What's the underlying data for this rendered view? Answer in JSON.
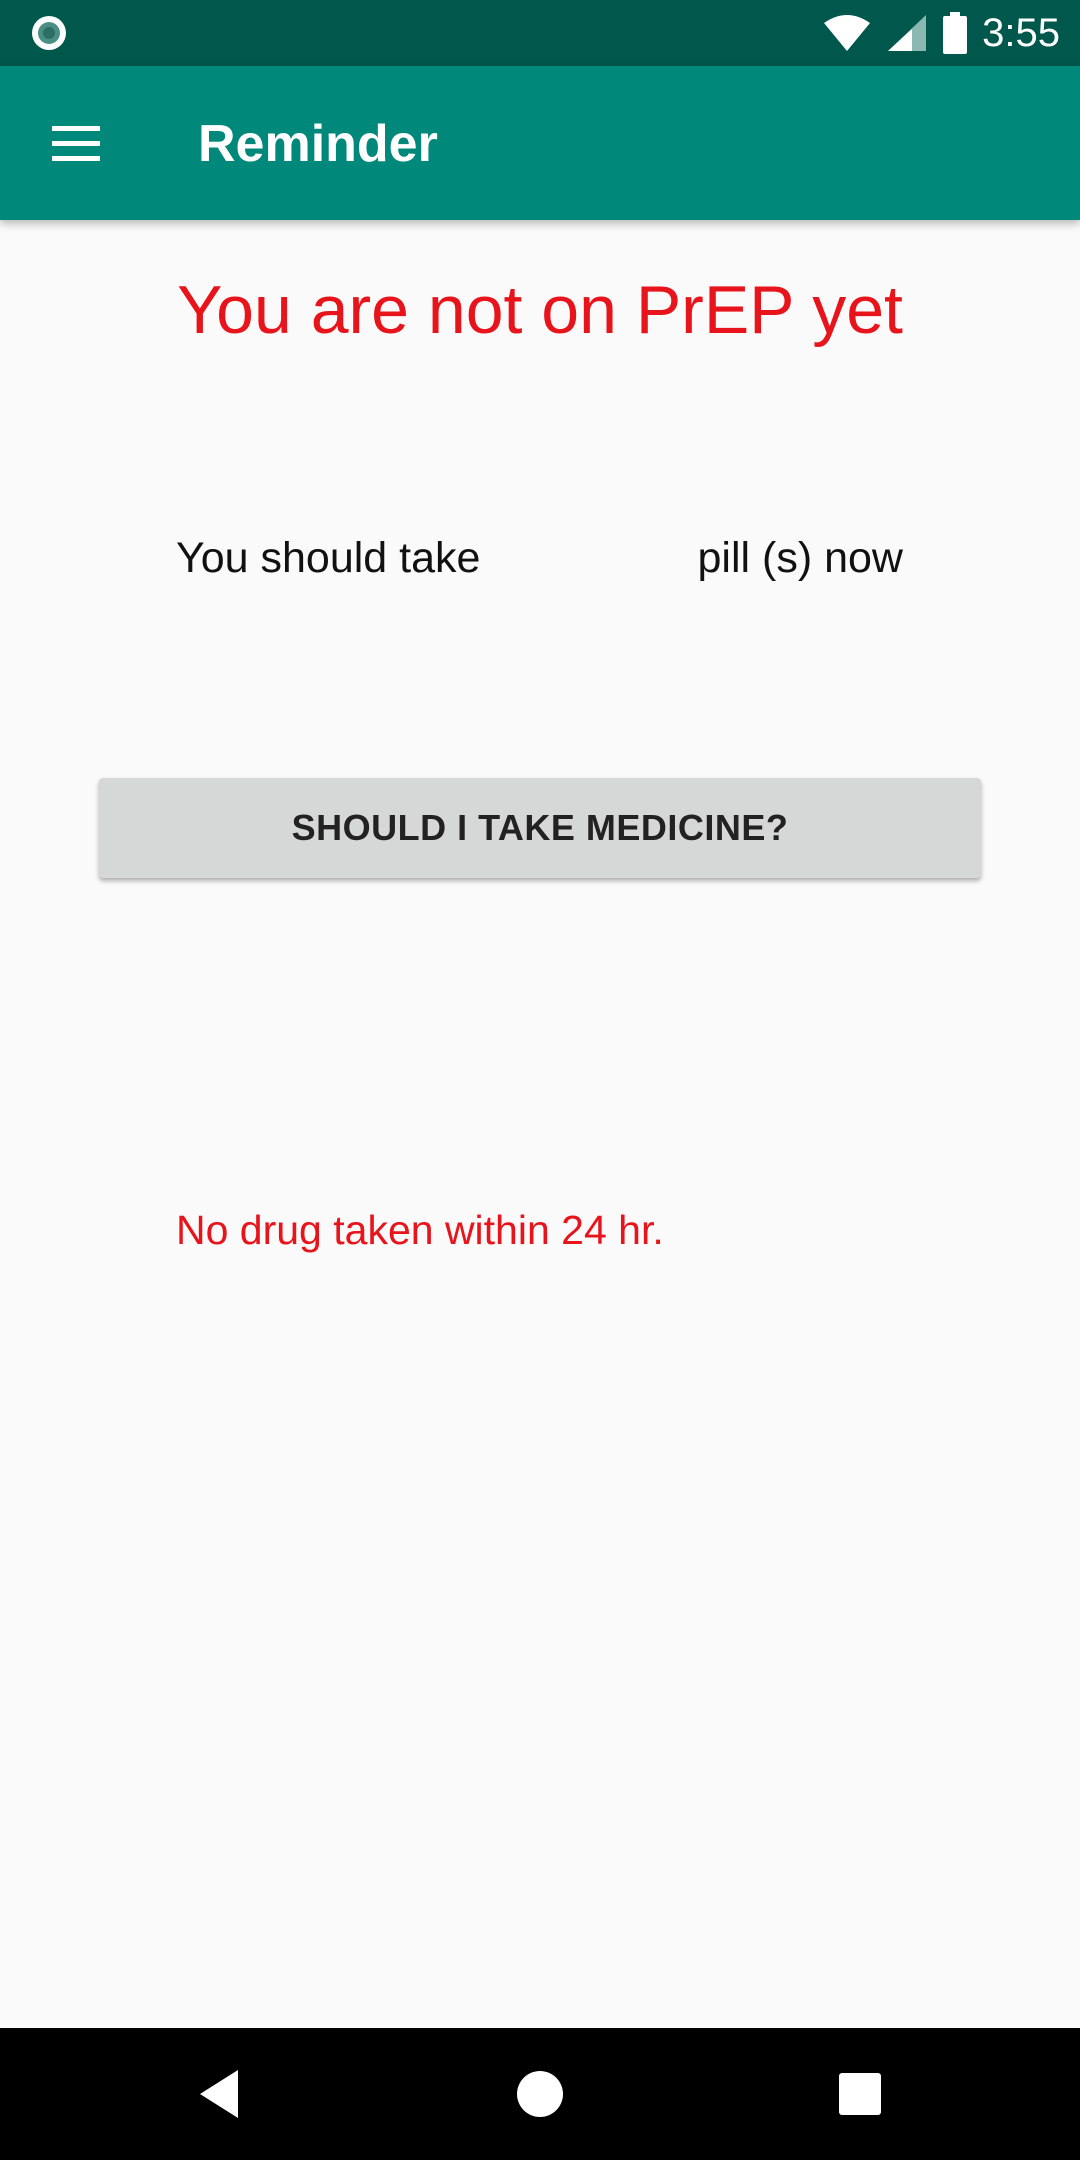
{
  "status_bar": {
    "time": "3:55",
    "icons": [
      "notification-dot-icon",
      "wifi-icon",
      "signal-icon",
      "battery-icon"
    ]
  },
  "app_bar": {
    "title": "Reminder",
    "menu_icon": "hamburger-menu-icon",
    "background_color": "#00897b"
  },
  "main": {
    "headline": "You are not on PrEP yet",
    "take_prefix": "You should take",
    "pill_count": "",
    "take_suffix": "pill (s) now",
    "button_label": "SHOULD I TAKE MEDICINE?",
    "status_message": "No drug taken within 24 hr.",
    "alert_color": "#e8141b"
  },
  "nav_bar": {
    "icons": [
      "back-icon",
      "home-icon",
      "recents-icon"
    ]
  }
}
